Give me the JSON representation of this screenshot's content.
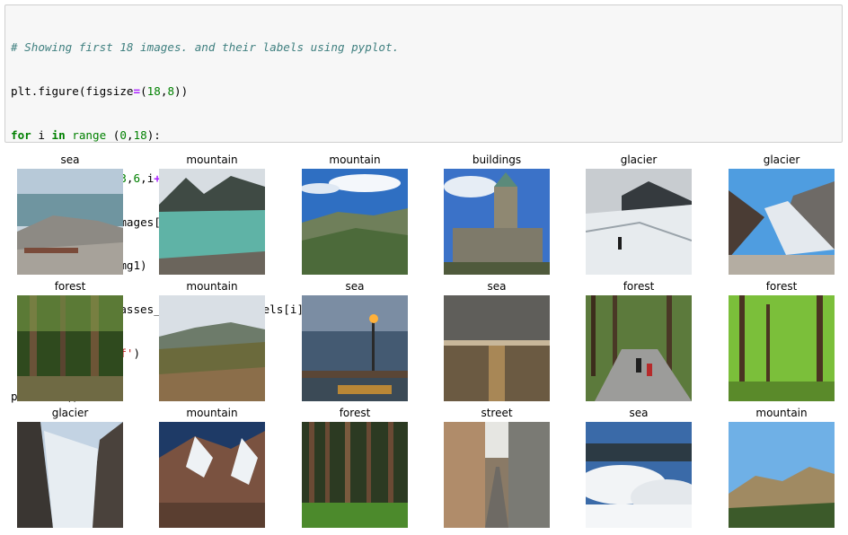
{
  "code_cell": {
    "lines": [
      "# Showing first 18 images. and their labels using pyplot.",
      "plt.figure(figsize=(18,8))",
      "for i in range (0,18):",
      "    plt.subplot(3,6,i+1)",
      "    img1=train_images[i]",
      "    plt.imshow(img1)",
      "    plt.title(classes_names[train_labels[i]])",
      "    plt.axis('off')",
      "plt.show()"
    ]
  },
  "output": {
    "titles": [
      "sea",
      "mountain",
      "mountain",
      "buildings",
      "glacier",
      "glacier",
      "forest",
      "mountain",
      "sea",
      "sea",
      "forest",
      "forest",
      "glacier",
      "mountain",
      "forest",
      "street",
      "sea",
      "mountain"
    ]
  }
}
